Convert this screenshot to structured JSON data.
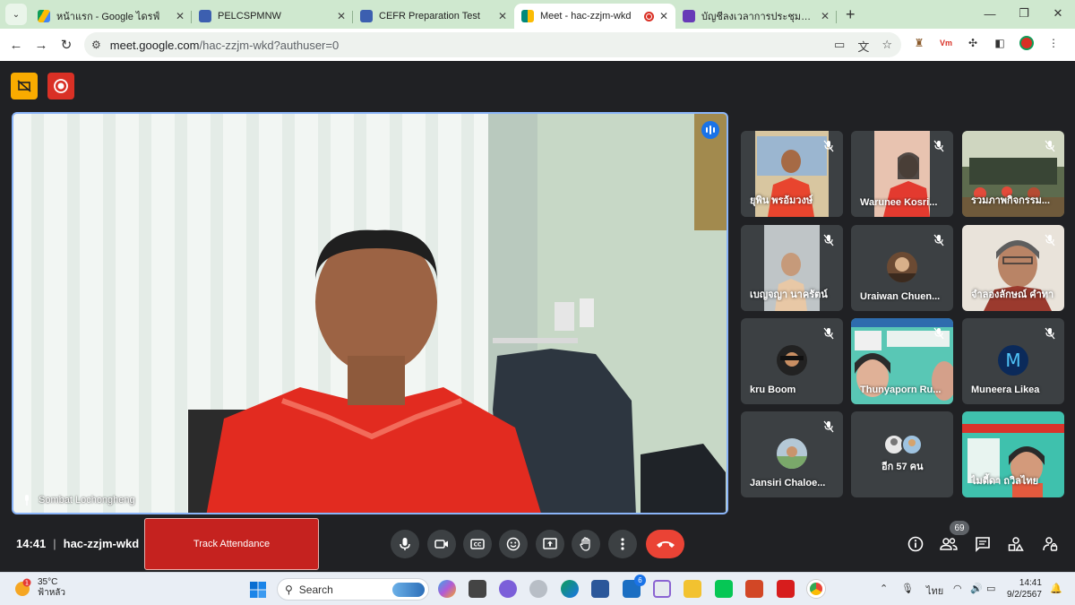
{
  "browser": {
    "tabs": [
      {
        "title": "หน้าแรก - Google ไดรฟ์",
        "color": "#1a73e8"
      },
      {
        "title": "PELCSPMNW",
        "color": "#3c5fb0"
      },
      {
        "title": "CEFR Preparation Test",
        "color": "#3c5fb0"
      },
      {
        "title": "Meet - hac-zzjm-wkd",
        "color": "#00897b"
      },
      {
        "title": "บัญชีลงเวลาการประชุมสอบ CEFR ปี",
        "color": "#673ab7"
      }
    ],
    "url_host": "meet.google.com",
    "url_path": "/hac-zzjm-wkd?authuser=0"
  },
  "meeting": {
    "speaker_name": "Sombat Lochongheng",
    "time": "14:41",
    "code": "hac-zzjm-wkd",
    "track_attendance_label": "Track Attendance",
    "participant_count": "69",
    "tiles": [
      {
        "name": "ยุพิน พรอ้มวงษ์"
      },
      {
        "name": "Warunee Kosri..."
      },
      {
        "name": "รวมภาพกิจกรรม..."
      },
      {
        "name": "เบญจญา นาครัตน์"
      },
      {
        "name": "Uraiwan Chuen..."
      },
      {
        "name": "จำลองลักษณ์ คำทา"
      },
      {
        "name": "kru Boom"
      },
      {
        "name": "Thunyaporn Ru..."
      },
      {
        "name": "Muneera Likea"
      },
      {
        "name": "Jansiri Chaloe..."
      },
      {
        "name": "อีก 57 คน"
      },
      {
        "name": "ไมตี้ดา ถวิลไทย"
      }
    ]
  },
  "taskbar": {
    "temperature": "35°C",
    "weather_desc": "ฟ้าหลัว",
    "weather_alert": "1",
    "search_label": "Search",
    "lang": "ไทย",
    "clock_time": "14:41",
    "clock_date": "9/2/2567",
    "mail_badge": "6"
  }
}
